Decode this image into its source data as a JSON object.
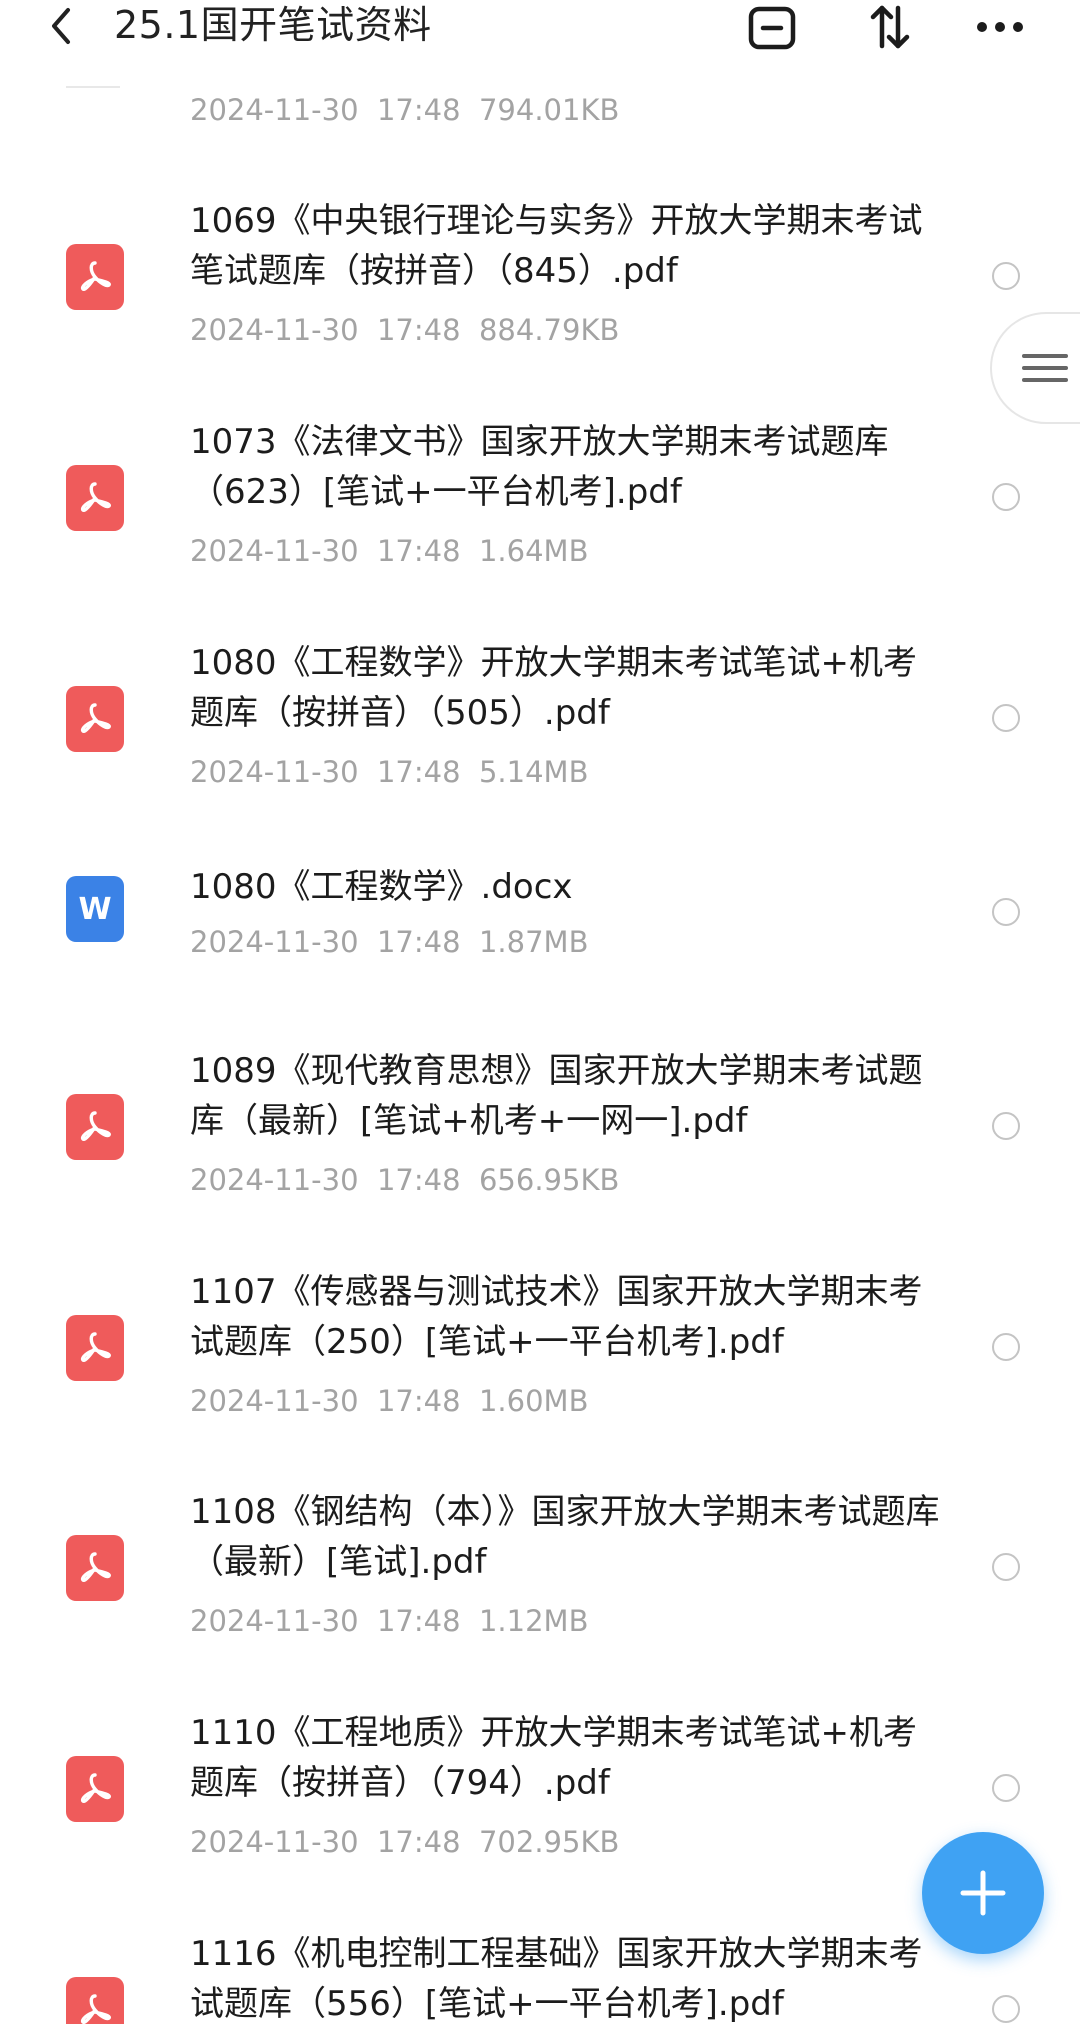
{
  "header": {
    "title": "25.1国开笔试资料"
  },
  "icons": {
    "back": "chevron-left-icon",
    "select": "select-box-icon",
    "sort": "sort-arrows-icon",
    "more": "more-dots-icon",
    "menu": "menu-lines-icon",
    "add": "plus-icon",
    "pdf": "pdf-file-icon",
    "word": "word-file-icon"
  },
  "colors": {
    "pdf": "#ef5b5b",
    "word": "#3b82e6",
    "fab": "#3fa2f3",
    "meta": "#a3a3a3"
  },
  "files": [
    {
      "name": "",
      "meta": "2024-11-30  17:48  794.01KB",
      "type": "none"
    },
    {
      "name": "1069《中央银行理论与实务》开放大学期末考试笔试题库（按拼音）（845）.pdf",
      "meta": "2024-11-30  17:48  884.79KB",
      "type": "pdf"
    },
    {
      "name": "1073《法律文书》国家开放大学期末考试题库（623）[笔试+一平台机考].pdf",
      "meta": "2024-11-30  17:48  1.64MB",
      "type": "pdf"
    },
    {
      "name": "1080《工程数学》开放大学期末考试笔试+机考题库（按拼音）（505）.pdf",
      "meta": "2024-11-30  17:48  5.14MB",
      "type": "pdf"
    },
    {
      "name": "1080《工程数学》.docx",
      "meta": "2024-11-30  17:48  1.87MB",
      "type": "doc",
      "icon_letter": "W"
    },
    {
      "name": "1089《现代教育思想》国家开放大学期末考试题库（最新）[笔试+机考+一网一].pdf",
      "meta": "2024-11-30  17:48  656.95KB",
      "type": "pdf"
    },
    {
      "name": "1107《传感器与测试技术》国家开放大学期末考试题库（250）[笔试+一平台机考].pdf",
      "meta": "2024-11-30  17:48  1.60MB",
      "type": "pdf"
    },
    {
      "name": "1108《钢结构（本）》国家开放大学期末考试题库（最新）[笔试].pdf",
      "meta": "2024-11-30  17:48  1.12MB",
      "type": "pdf"
    },
    {
      "name": "1110《工程地质》开放大学期末考试笔试+机考题库（按拼音）（794）.pdf",
      "meta": "2024-11-30  17:48  702.95KB",
      "type": "pdf"
    },
    {
      "name": "1116《机电控制工程基础》国家开放大学期末考试题库（556）[笔试+一平台机考].pdf",
      "meta": "",
      "type": "pdf"
    }
  ]
}
